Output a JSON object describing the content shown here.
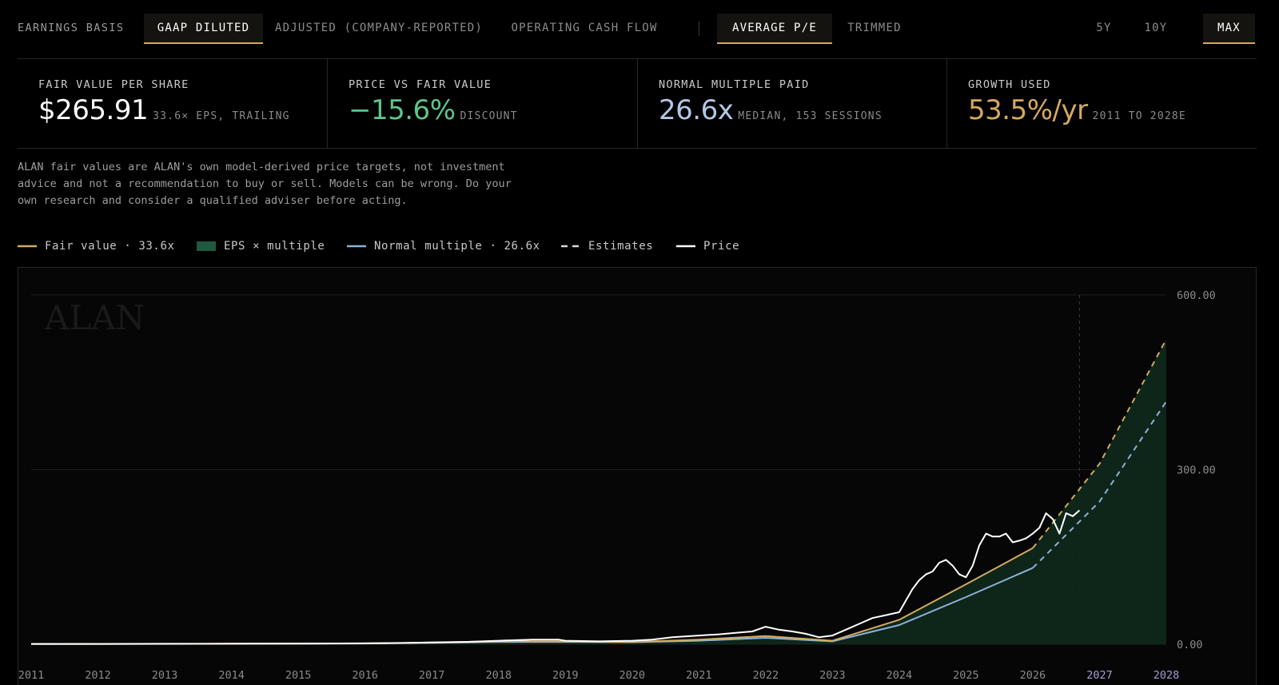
{
  "toolbar": {
    "basis_label": "EARNINGS BASIS",
    "basis_tabs": [
      {
        "label": "GAAP DILUTED",
        "active": true
      },
      {
        "label": "ADJUSTED (COMPANY-REPORTED)",
        "active": false
      },
      {
        "label": "OPERATING CASH FLOW",
        "active": false
      }
    ],
    "method_tabs": [
      {
        "label": "AVERAGE P/E",
        "active": true
      },
      {
        "label": "TRIMMED",
        "active": false
      }
    ],
    "range_tabs": [
      {
        "label": "5Y",
        "active": false
      },
      {
        "label": "10Y",
        "active": false
      },
      {
        "label": "MAX",
        "active": true
      }
    ]
  },
  "stats": [
    {
      "label": "FAIR VALUE PER SHARE",
      "value": "$265.91",
      "sub": "33.6× EPS, TRAILING",
      "color": "#ffffff"
    },
    {
      "label": "PRICE VS FAIR VALUE",
      "value": "−15.6%",
      "sub": "DISCOUNT",
      "color": "#5fc48a"
    },
    {
      "label": "NORMAL MULTIPLE PAID",
      "value": "26.6x",
      "sub": "MEDIAN, 153 SESSIONS",
      "color": "#b4c6e4"
    },
    {
      "label": "GROWTH USED",
      "value": "53.5%/yr",
      "sub": "2011 TO 2028E",
      "color": "#d6a95e"
    }
  ],
  "disclaimer": "ALAN fair values are ALAN's own model-derived price targets, not investment advice and not a recommendation to buy or sell. Models can be wrong. Do your own research and consider a qualified adviser before acting.",
  "legend": [
    {
      "label": "Fair value · 33.6x",
      "kind": "line",
      "color": "#d6a95e"
    },
    {
      "label": "EPS × multiple",
      "kind": "box",
      "color": "#1f5a3e"
    },
    {
      "label": "Normal multiple · 26.6x",
      "kind": "line",
      "color": "#8fb0d8"
    },
    {
      "label": "Estimates",
      "kind": "dash",
      "color": "#d8d8d8"
    },
    {
      "label": "Price",
      "kind": "line",
      "color": "#ffffff"
    }
  ],
  "chart_data": {
    "type": "line",
    "watermark": "ALAN",
    "xlim": [
      2011,
      2028
    ],
    "ylim": [
      0,
      600
    ],
    "y_ticks": [
      "600.00",
      "300.00",
      "0.00"
    ],
    "y_tick_values": [
      600,
      300,
      0
    ],
    "x_ticks": [
      "2011",
      "2012",
      "2013",
      "2014",
      "2015",
      "2016",
      "2017",
      "2018",
      "2019",
      "2020",
      "2021",
      "2022",
      "2023",
      "2024",
      "2025",
      "2026",
      "2027",
      "2028"
    ],
    "estimate_ticks": [
      "2027",
      "2028"
    ],
    "estimate_start": 2026.7,
    "grid": true,
    "colors": {
      "fair": "#d6a95e",
      "normal": "#8fb0d8",
      "price": "#ffffff",
      "area": "#0f2a1d",
      "estimate_tick": "#a89bd6",
      "tick": "#8a8a8a"
    },
    "series": [
      {
        "name": "Fair value · 33.6x",
        "key": "fair",
        "x": [
          2011,
          2012,
          2013,
          2014,
          2015,
          2016,
          2017,
          2018,
          2019,
          2020,
          2021,
          2022,
          2023,
          2024,
          2025,
          2026
        ],
        "y": [
          0.5,
          0.6,
          0.7,
          0.8,
          1.0,
          1.5,
          3,
          5,
          5,
          4,
          8,
          14,
          6,
          42,
          103,
          165
        ]
      },
      {
        "name": "Fair value · 33.6x",
        "key": "fair_est",
        "x": [
          2026,
          2027,
          2028
        ],
        "y": [
          165,
          310,
          524
        ]
      },
      {
        "name": "Normal multiple · 26.6x",
        "key": "normal",
        "x": [
          2011,
          2012,
          2013,
          2014,
          2015,
          2016,
          2017,
          2018,
          2019,
          2020,
          2021,
          2022,
          2023,
          2024,
          2025,
          2026
        ],
        "y": [
          0.4,
          0.5,
          0.6,
          0.7,
          0.8,
          1.2,
          2.5,
          4,
          4,
          3.5,
          6,
          11,
          5,
          33,
          81,
          131
        ]
      },
      {
        "name": "Normal multiple · 26.6x",
        "key": "normal_est",
        "x": [
          2026,
          2027,
          2028
        ],
        "y": [
          131,
          245,
          417
        ]
      },
      {
        "name": "Price",
        "key": "price",
        "x": [
          2011,
          2012,
          2013,
          2014,
          2015,
          2016,
          2016.5,
          2017,
          2017.5,
          2018,
          2018.5,
          2018.9,
          2019,
          2019.5,
          2020,
          2020.3,
          2020.6,
          2021,
          2021.3,
          2021.6,
          2021.8,
          2022,
          2022.2,
          2022.4,
          2022.6,
          2022.8,
          2023,
          2023.2,
          2023.4,
          2023.6,
          2023.8,
          2024,
          2024.1,
          2024.2,
          2024.3,
          2024.4,
          2024.5,
          2024.6,
          2024.7,
          2024.8,
          2024.9,
          2025,
          2025.1,
          2025.2,
          2025.3,
          2025.4,
          2025.5,
          2025.6,
          2025.7,
          2025.8,
          2025.9,
          2026,
          2026.1,
          2026.2,
          2026.3,
          2026.4,
          2026.5,
          2026.6,
          2026.7
        ],
        "y": [
          0.5,
          0.6,
          0.8,
          1,
          1.2,
          1.5,
          2,
          3,
          4,
          6,
          8,
          8,
          6,
          5,
          6,
          8,
          12,
          15,
          17,
          20,
          22,
          30,
          25,
          22,
          18,
          12,
          15,
          25,
          35,
          45,
          50,
          55,
          75,
          95,
          110,
          120,
          125,
          140,
          145,
          135,
          120,
          115,
          135,
          170,
          190,
          185,
          185,
          190,
          175,
          178,
          182,
          190,
          200,
          225,
          215,
          190,
          225,
          220,
          230
        ]
      }
    ]
  }
}
